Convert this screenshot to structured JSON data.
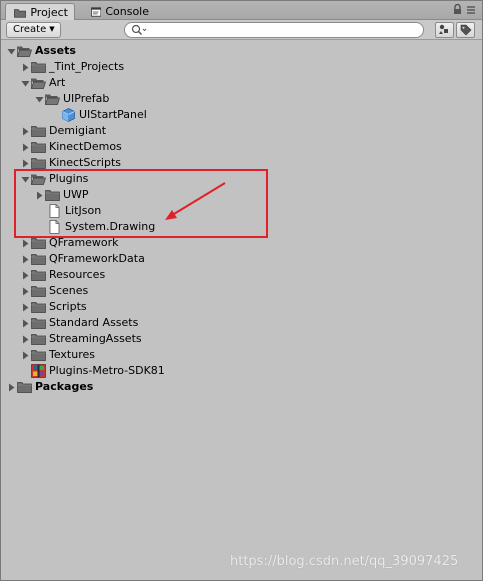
{
  "tabs": [
    {
      "label": "Project",
      "icon": "folder-icon",
      "active": true
    },
    {
      "label": "Console",
      "icon": "console-icon",
      "active": false
    }
  ],
  "window_controls": {
    "lock_icon": "lock-icon",
    "menu_icon": "menu-icon"
  },
  "toolbar": {
    "create_label": "Create",
    "search_placeholder": "",
    "filter_icon": "filter-by-type-icon",
    "label_icon": "filter-by-label-icon"
  },
  "tree": [
    {
      "label": "Assets",
      "bold": true,
      "expanded": true,
      "icon": "folder-open-icon"
    },
    {
      "label": "_Tint_Projects",
      "expanded": false,
      "icon": "folder-icon"
    },
    {
      "label": "Art",
      "expanded": true,
      "icon": "folder-open-icon"
    },
    {
      "label": "UIPrefab",
      "expanded": true,
      "icon": "folder-open-icon"
    },
    {
      "label": "UIStartPanel",
      "icon": "prefab-cube-icon"
    },
    {
      "label": "Demigiant",
      "expanded": false,
      "icon": "folder-icon"
    },
    {
      "label": "KinectDemos",
      "expanded": false,
      "icon": "folder-icon"
    },
    {
      "label": "KinectScripts",
      "expanded": false,
      "icon": "folder-icon"
    },
    {
      "label": "Plugins",
      "expanded": true,
      "icon": "folder-open-icon"
    },
    {
      "label": "UWP",
      "expanded": false,
      "icon": "folder-icon"
    },
    {
      "label": "LitJson",
      "icon": "file-icon"
    },
    {
      "label": "System.Drawing",
      "icon": "file-icon"
    },
    {
      "label": "QFramework",
      "expanded": false,
      "icon": "folder-icon"
    },
    {
      "label": "QFrameworkData",
      "expanded": false,
      "icon": "folder-icon"
    },
    {
      "label": "Resources",
      "expanded": false,
      "icon": "folder-icon"
    },
    {
      "label": "Scenes",
      "expanded": false,
      "icon": "folder-icon"
    },
    {
      "label": "Scripts",
      "expanded": false,
      "icon": "folder-icon"
    },
    {
      "label": "Standard Assets",
      "expanded": false,
      "icon": "folder-icon"
    },
    {
      "label": "StreamingAssets",
      "expanded": false,
      "icon": "folder-icon"
    },
    {
      "label": "Textures",
      "expanded": false,
      "icon": "folder-icon"
    },
    {
      "label": "Plugins-Metro-SDK81",
      "icon": "unity-package-icon"
    },
    {
      "label": "Packages",
      "bold": true,
      "expanded": false,
      "icon": "folder-icon"
    }
  ],
  "annotation": {
    "color": "#e0202a"
  },
  "watermark": "https://blog.csdn.net/qq_39097425"
}
